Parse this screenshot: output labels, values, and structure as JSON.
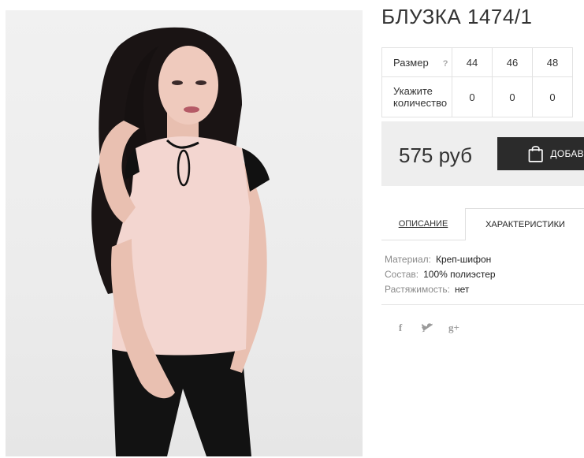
{
  "product": {
    "title": "БЛУЗКА 1474/1",
    "image_alt": "Model wearing pink sleeveless blouse with black trim"
  },
  "sizes": {
    "label": "Размер",
    "help_symbol": "?",
    "values": [
      "44",
      "46",
      "48"
    ],
    "quantity_label_line1": "Укажите",
    "quantity_label_line2": "количество",
    "quantities": [
      "0",
      "0",
      "0"
    ]
  },
  "price": {
    "amount": "575 руб",
    "add_button_label": "ДОБАВ"
  },
  "tabs": {
    "description": "ОПИСАНИЕ",
    "characteristics": "ХАРАКТЕРИСТИКИ"
  },
  "characteristics": [
    {
      "key": "Материал:",
      "value": "Креп-шифон"
    },
    {
      "key": "Состав:",
      "value": "100% полиэстер"
    },
    {
      "key": "Растяжимость:",
      "value": "нет"
    }
  ],
  "social": {
    "facebook": "f",
    "twitter": "twitter",
    "googleplus": "g+"
  },
  "colors": {
    "accent_dark": "#2b2b2b",
    "price_bg": "#eeeeee",
    "blouse": "#f3d6d0"
  }
}
